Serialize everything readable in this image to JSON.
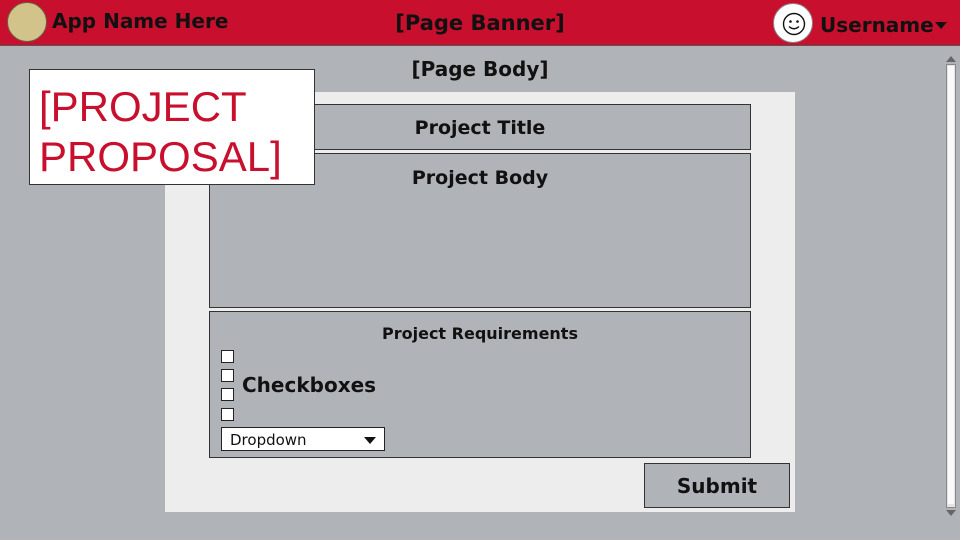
{
  "banner": {
    "app_name": "App Name Here",
    "title": "[Page Banner]",
    "username": "Username",
    "logo_icon": "app-logo-icon",
    "avatar_icon": "smiley-face-icon",
    "background_color": "#c8102e"
  },
  "page": {
    "body_label": "[Page Body]",
    "overlay_title": "[PROJECT PROPOSAL]"
  },
  "form": {
    "title_label": "Project Title",
    "body_label": "Project Body",
    "requirements": {
      "title": "Project Requirements",
      "checkboxes_label": "Checkboxes",
      "checkbox_count": 4,
      "dropdown_value": "Dropdown"
    },
    "submit_label": "Submit"
  }
}
